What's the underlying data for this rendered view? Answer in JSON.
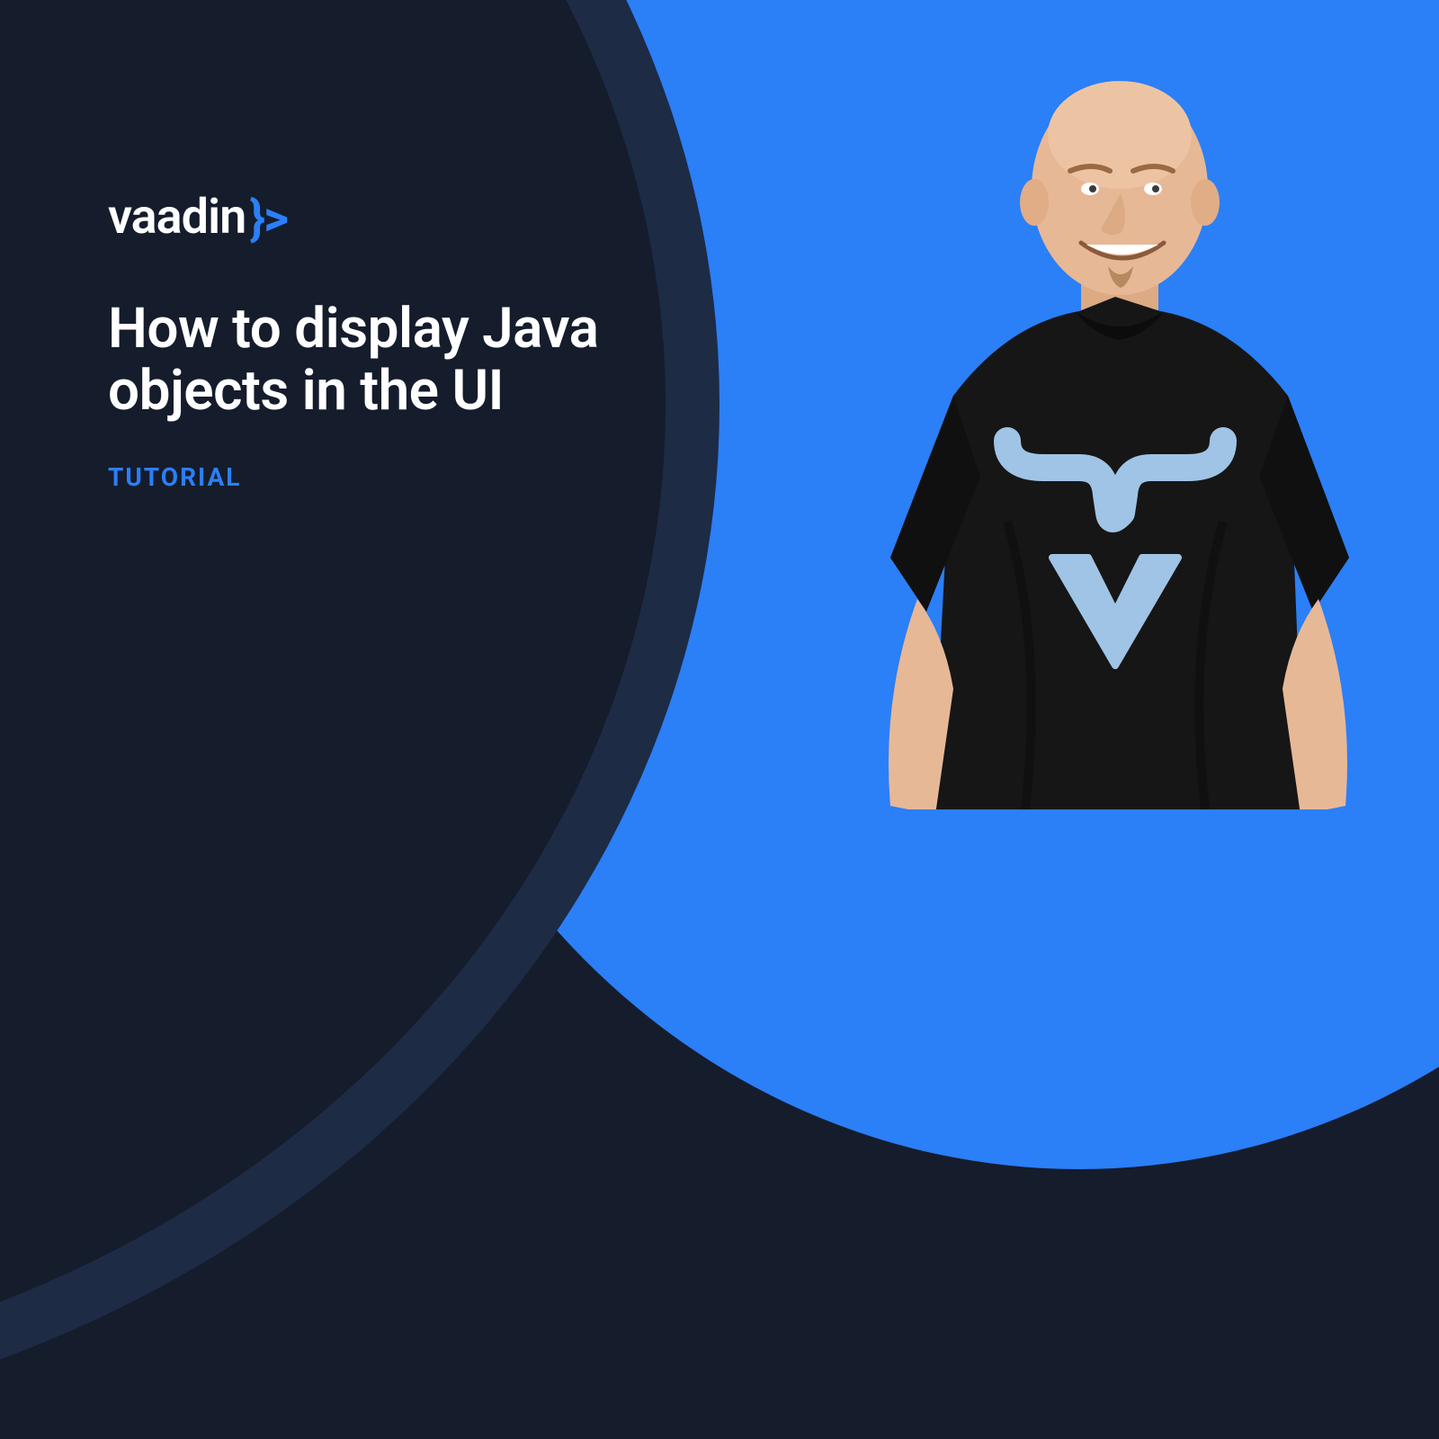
{
  "brand": {
    "name": "vaadin",
    "glyph": "}>",
    "accent_color": "#2b7ff7"
  },
  "thumbnail": {
    "title": "How  to display Java objects in the UI",
    "category_label": "TUTORIAL"
  },
  "colors": {
    "background_dark": "#151c2c",
    "arc_border": "#1d2b45",
    "accent_blue": "#2b7ff7",
    "text_white": "#ffffff",
    "shirt_logo": "#9fc4e6",
    "shirt_dark": "#101010",
    "skin": "#e7b896"
  },
  "presenter": {
    "description": "person-wearing-black-vaadin-tshirt",
    "shirt_icon": "vaadin-brace-v-icon"
  }
}
